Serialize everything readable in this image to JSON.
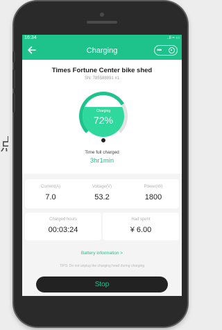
{
  "background": {
    "glyph": "点"
  },
  "status_bar": {
    "time": "16:34",
    "icons": "..ll ≈ ▭"
  },
  "nav": {
    "title": "Charging",
    "more_label": "•••",
    "back_icon": "arrow-left-icon",
    "close_icon": "target-close-icon"
  },
  "station": {
    "name": "Times Fortune Center bike shed",
    "serial": "SN: 785588891 #1"
  },
  "gauge": {
    "label": "Charging",
    "percent_text": "72%",
    "percent": 72
  },
  "full_charge": {
    "label": "Time full charged",
    "value": "3hr1min"
  },
  "metrics": [
    {
      "label": "Current(A)",
      "value": "7.0"
    },
    {
      "label": "Voltage(V)",
      "value": "53.2"
    },
    {
      "label": "Power(W)",
      "value": "1800"
    }
  ],
  "charged_hours": {
    "label": "Charged hours",
    "value": "00:03:24"
  },
  "spent": {
    "label": "Had spent",
    "value": "¥ 6.00"
  },
  "battery_link": "Battery information >",
  "tips": "TIPS: Do not unplug the charging head during charging",
  "stop_label": "Stop",
  "colors": {
    "accent": "#1ec38b",
    "fill": "#2fd99d",
    "button_bg": "#222222"
  }
}
